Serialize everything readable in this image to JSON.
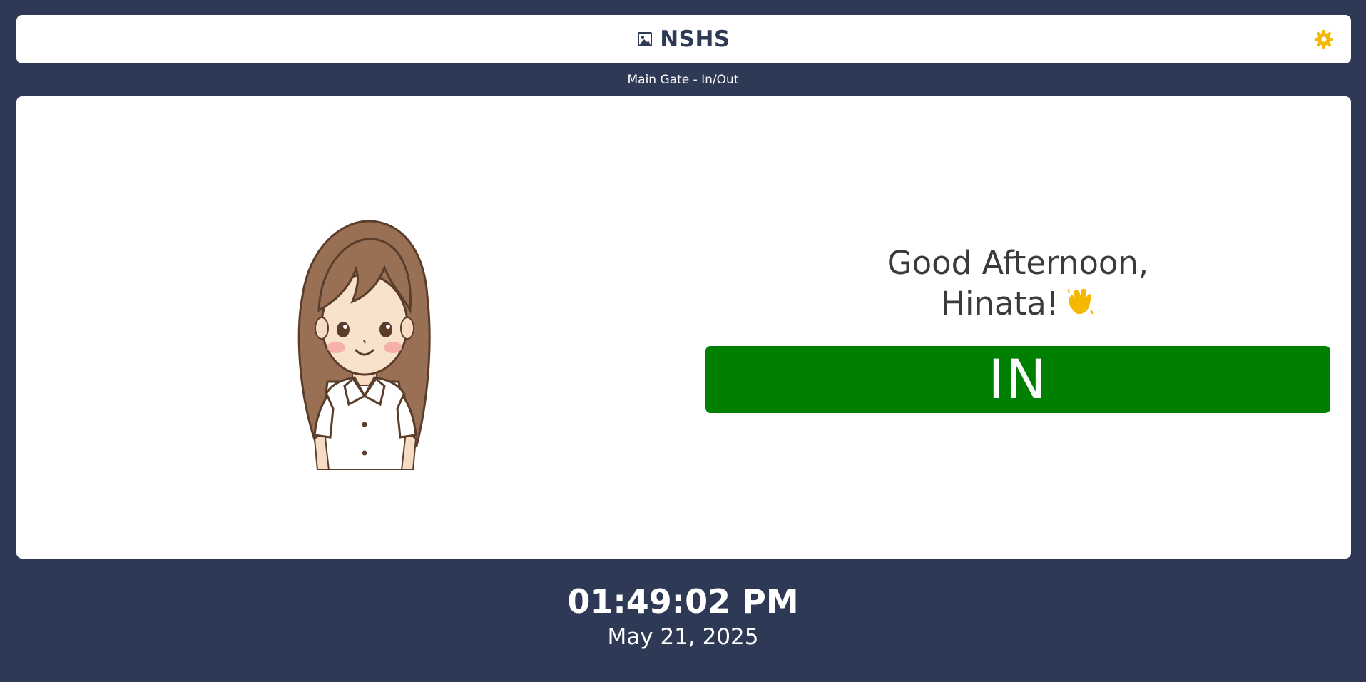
{
  "header": {
    "logo_icon": "image-icon",
    "brand": "NSHS",
    "settings_icon": "gear-icon"
  },
  "location": "Main Gate - In/Out",
  "greeting": {
    "line1": "Good Afternoon,",
    "line2": "Hinata!",
    "emoji": "waving-hand-icon"
  },
  "status": {
    "label": "IN",
    "color": "#008000"
  },
  "clock": {
    "time": "01:49:02 PM",
    "date": "May 21, 2025"
  },
  "colors": {
    "background": "#2e3a55",
    "panel": "#ffffff",
    "accent": "#f5b800"
  }
}
